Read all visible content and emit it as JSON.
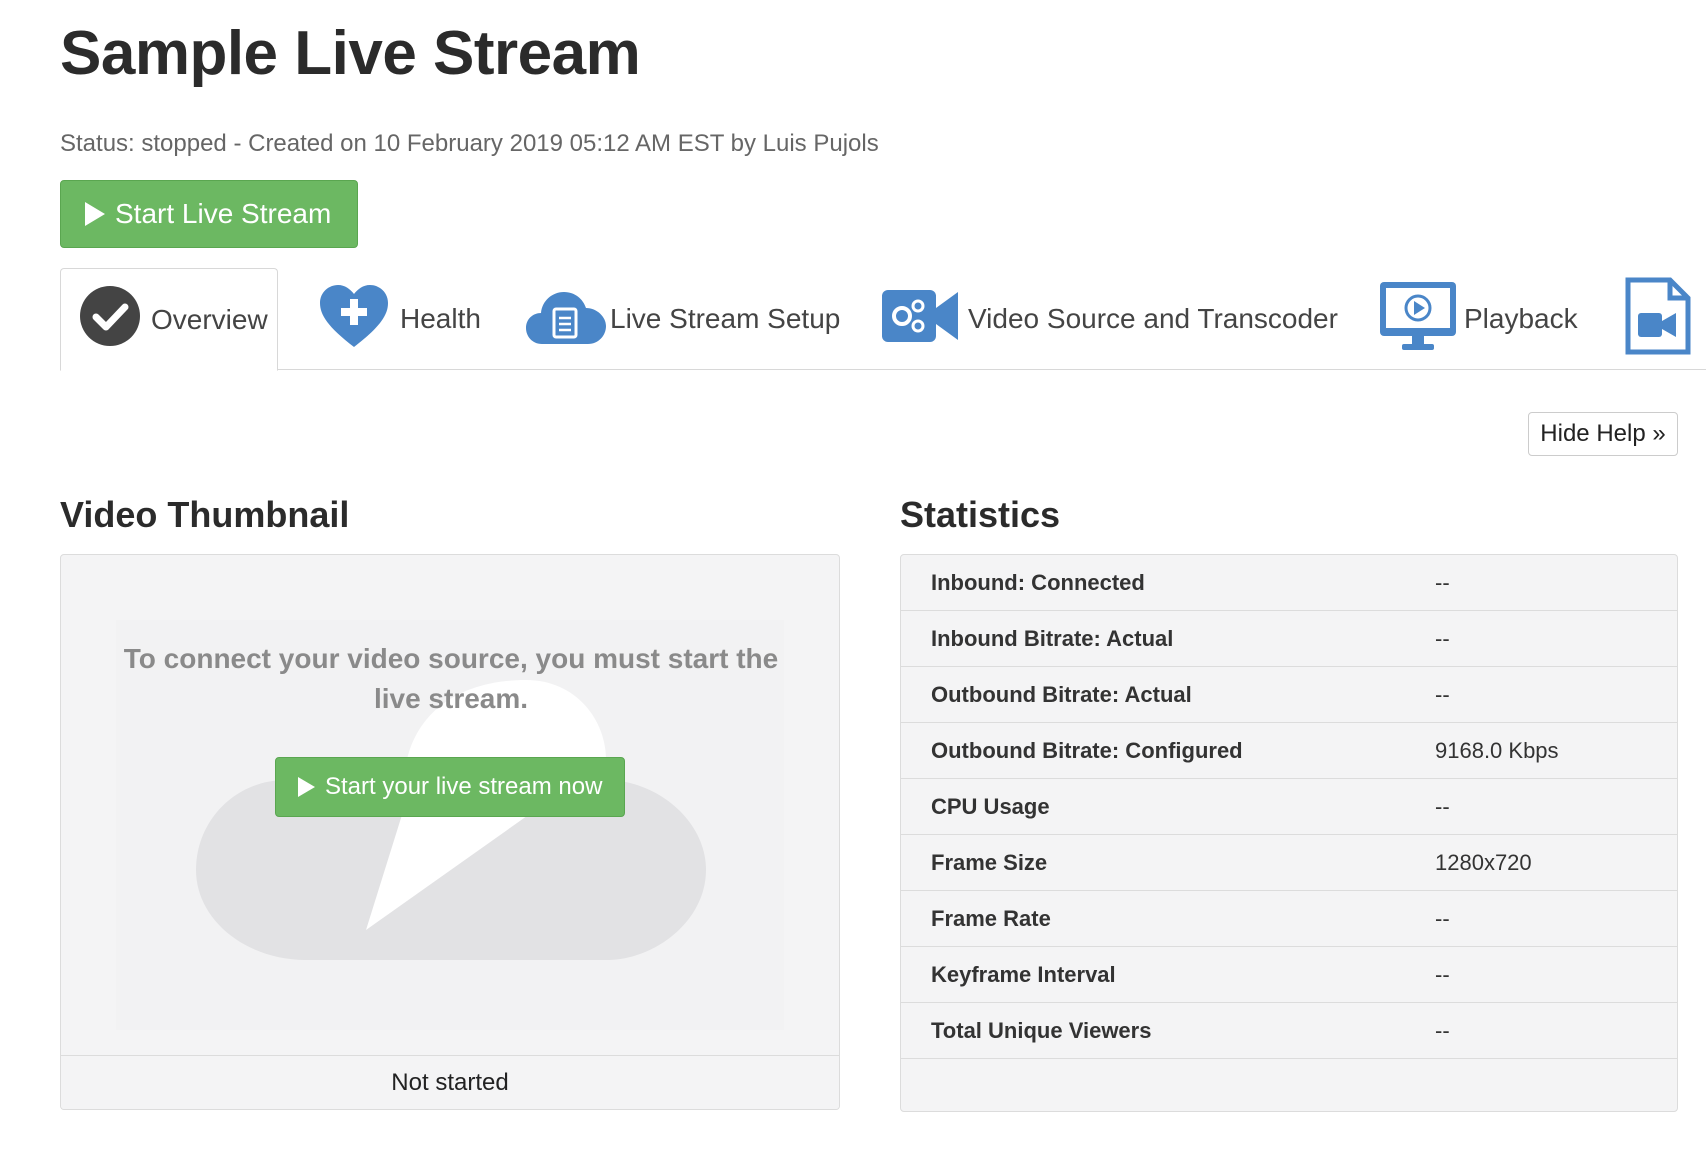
{
  "header": {
    "title": "Sample Live Stream",
    "status": "Status: stopped - Created on 10 February 2019 05:12 AM EST by Luis Pujols",
    "start_button": "Start Live Stream"
  },
  "tabs": [
    {
      "label": "Overview",
      "icon": "check-circle-icon",
      "active": true
    },
    {
      "label": "Health",
      "icon": "heart-plus-icon"
    },
    {
      "label": "Live Stream Setup",
      "icon": "cloud-document-icon"
    },
    {
      "label": "Video Source and Transcoder",
      "icon": "video-camera-gears-icon"
    },
    {
      "label": "Playback",
      "icon": "monitor-play-icon"
    },
    {
      "label": "",
      "icon": "video-file-icon"
    }
  ],
  "hide_help": "Hide Help »",
  "thumbnail": {
    "title": "Video Thumbnail",
    "message": "To connect your video source, you must start the live stream.",
    "button": "Start your live stream now",
    "footer": "Not started"
  },
  "statistics": {
    "title": "Statistics",
    "rows": [
      {
        "label": "Inbound: Connected",
        "value": "--"
      },
      {
        "label": "Inbound Bitrate: Actual",
        "value": "--"
      },
      {
        "label": "Outbound Bitrate: Actual",
        "value": "--"
      },
      {
        "label": "Outbound Bitrate: Configured",
        "value": "9168.0 Kbps"
      },
      {
        "label": "CPU Usage",
        "value": "--"
      },
      {
        "label": "Frame Size",
        "value": "1280x720"
      },
      {
        "label": "Frame Rate",
        "value": "--"
      },
      {
        "label": "Keyframe Interval",
        "value": "--"
      },
      {
        "label": "Total Unique Viewers",
        "value": "--"
      }
    ]
  },
  "colors": {
    "accent_green": "#6cb862",
    "icon_blue": "#4a86c8",
    "dark_icon": "#444444"
  }
}
